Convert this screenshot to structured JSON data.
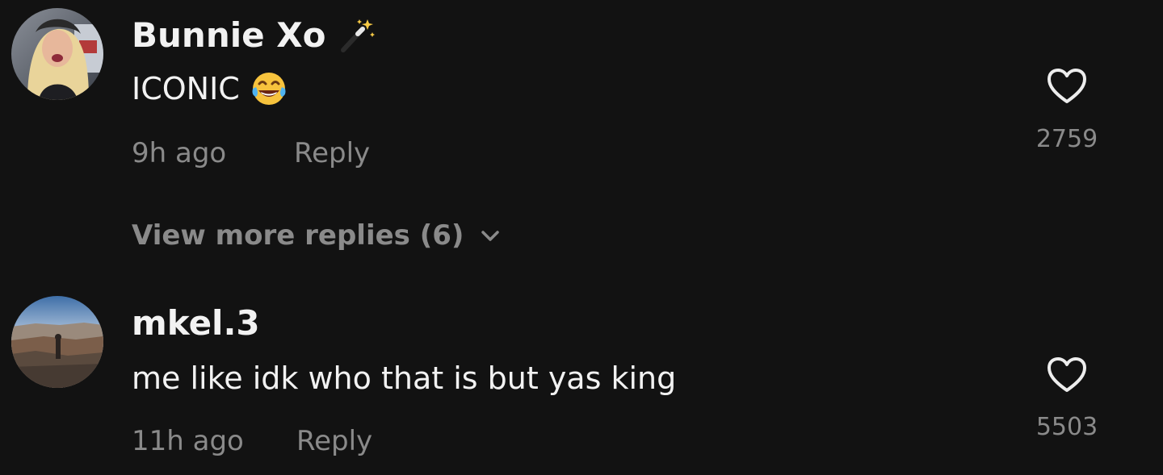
{
  "comments": [
    {
      "username": "Bunnie Xo",
      "text": "ICONIC",
      "time": "9h ago",
      "reply_label": "Reply",
      "likes": "2759",
      "view_more": "View more replies (6)",
      "icons": [
        "magic-wand-icon",
        "tears-of-joy-emoji",
        "heart-icon",
        "chevron-down-icon"
      ]
    },
    {
      "username": "mkel.3",
      "text": "me like idk who that is but yas king",
      "time": "11h ago",
      "reply_label": "Reply",
      "likes": "5503",
      "icons": [
        "heart-icon"
      ]
    }
  ],
  "colors": {
    "background": "#121212",
    "primary_text": "#f2f2f2",
    "secondary_text": "#8a8a8a"
  }
}
